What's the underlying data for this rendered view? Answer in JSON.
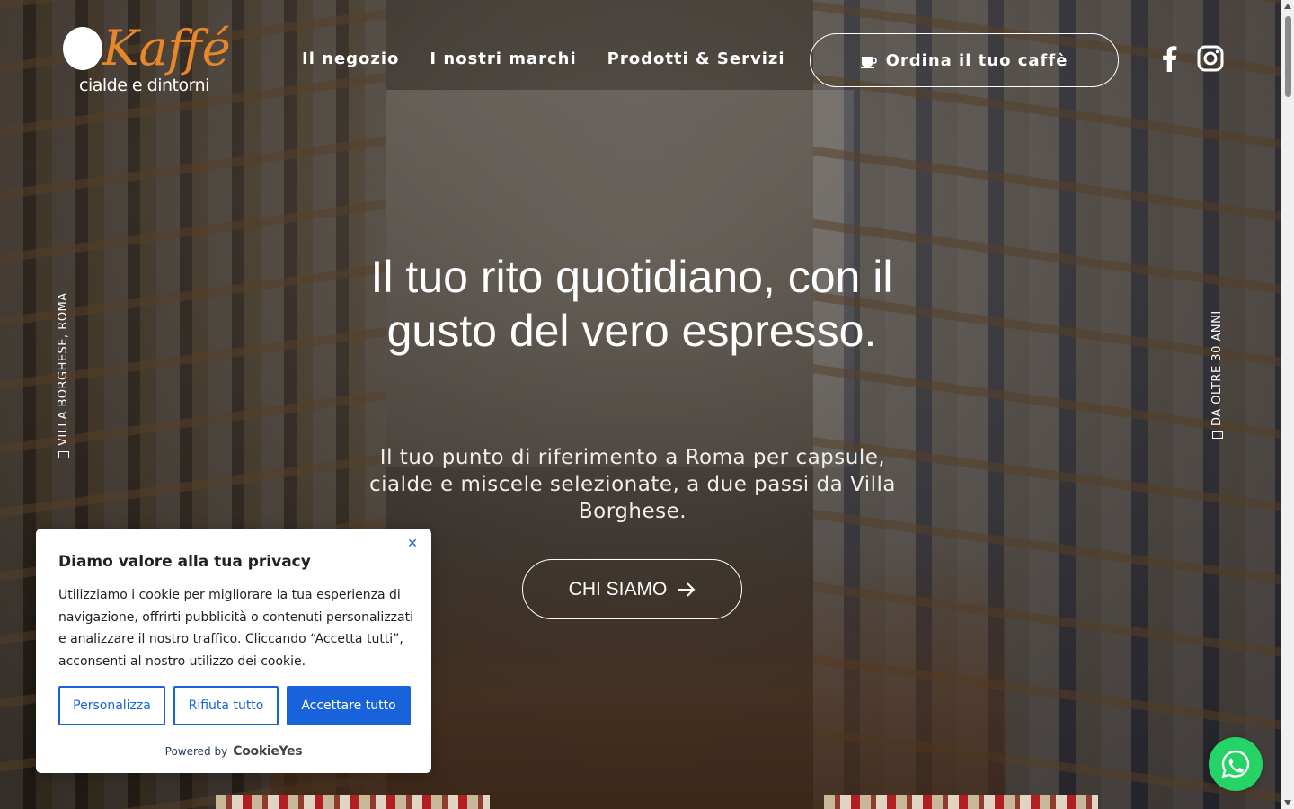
{
  "brand": {
    "logo_main": "Kaffé",
    "logo_sub": "cialde e dintorni",
    "accent": "#e8862a"
  },
  "nav": {
    "items": [
      {
        "label": "Il negozio"
      },
      {
        "label": "I nostri marchi"
      },
      {
        "label": "Prodotti & Servizi"
      }
    ],
    "order_button": "Ordina il tuo caffè"
  },
  "social": {
    "icons": [
      "facebook-icon",
      "instagram-icon"
    ]
  },
  "side": {
    "left": "VILLA BORGHESE, ROMA",
    "right": "DA OLTRE 30 ANNI"
  },
  "hero": {
    "headline": "Il tuo rito quotidiano, con il gusto del vero espresso.",
    "subline": "Il tuo punto di riferimento a Roma per capsule, cialde e miscele selezionate, a due passi da Villa Borghese.",
    "cta": "CHI SIAMO"
  },
  "cookie": {
    "title": "Diamo valore alla tua privacy",
    "text": "Utilizziamo i cookie per migliorare la tua esperienza di navigazione, offrirti pubblicità o contenuti personalizzati e analizzare il nostro traffico. Cliccando “Accetta tutti”, acconsenti al nostro utilizzo dei cookie.",
    "buttons": {
      "customize": "Personalizza",
      "reject": "Rifiuta tutto",
      "accept": "Accettare tutto"
    },
    "powered_by": "Powered by",
    "powered_brand": "CookieYes",
    "accent": "#1863dc"
  },
  "whatsapp": {
    "color": "#25d366"
  }
}
